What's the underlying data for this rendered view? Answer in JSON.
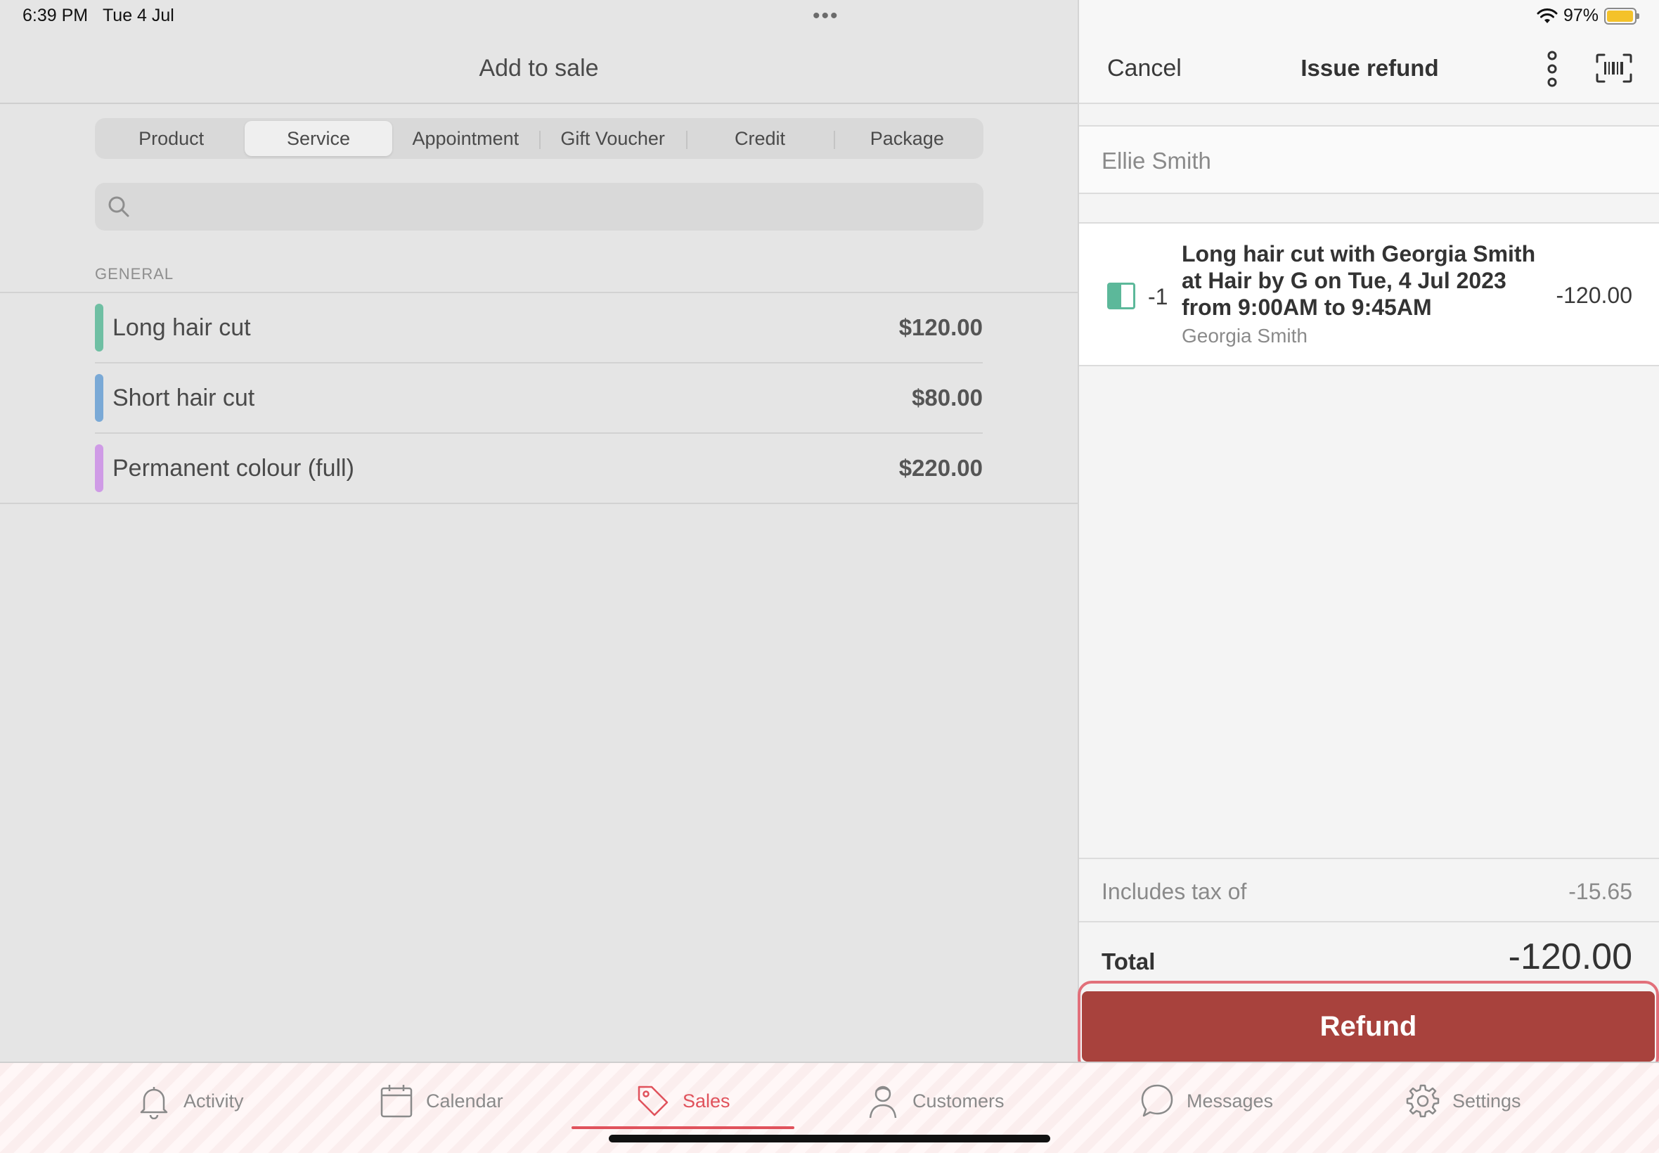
{
  "status_bar": {
    "time": "6:39 PM",
    "date": "Tue 4 Jul",
    "battery_percent": "97%",
    "battery_level": 0.97,
    "icons": [
      "wifi-icon",
      "battery-icon"
    ]
  },
  "left": {
    "title": "Add to sale",
    "segments": [
      "Product",
      "Service",
      "Appointment",
      "Gift Voucher",
      "Credit",
      "Package"
    ],
    "selected_segment": "Service",
    "search": {
      "placeholder": ""
    },
    "section_label": "GENERAL",
    "services": [
      {
        "name": "Long hair cut",
        "price": "$120.00",
        "color": "#6fbfa3"
      },
      {
        "name": "Short hair cut",
        "price": "$80.00",
        "color": "#7aa9d6"
      },
      {
        "name": "Permanent colour (full)",
        "price": "$220.00",
        "color": "#cf9be6"
      }
    ]
  },
  "right": {
    "cancel_label": "Cancel",
    "title": "Issue refund",
    "customer": "Ellie Smith",
    "item": {
      "quantity": "-1",
      "description": "Long hair cut with Georgia Smith at Hair by G on Tue, 4 Jul 2023 from 9:00AM to 9:45AM",
      "staff": "Georgia Smith",
      "price": "-120.00",
      "color": "#5cb89a"
    },
    "tax_label": "Includes tax of",
    "tax_value": "-15.65",
    "total_label": "Total",
    "total_value": "-120.00",
    "refund_button": "Refund",
    "refund_color": "#a8423d"
  },
  "tab_bar": {
    "tabs": [
      {
        "label": "Activity",
        "icon": "bell-icon"
      },
      {
        "label": "Calendar",
        "icon": "calendar-icon"
      },
      {
        "label": "Sales",
        "icon": "tag-icon"
      },
      {
        "label": "Customers",
        "icon": "person-icon"
      },
      {
        "label": "Messages",
        "icon": "chat-bubble-icon"
      },
      {
        "label": "Settings",
        "icon": "gear-icon"
      }
    ],
    "active": "Sales",
    "accent_color": "#e0525c"
  }
}
